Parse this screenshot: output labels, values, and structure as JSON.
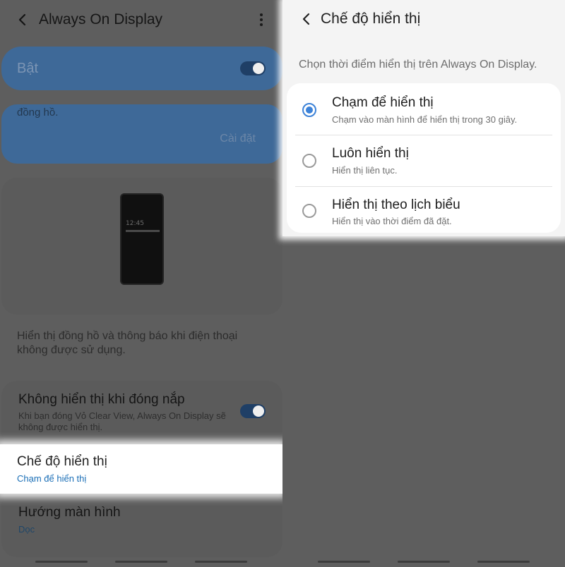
{
  "left": {
    "header": {
      "title": "Always On Display"
    },
    "master_toggle": {
      "label": "Bật",
      "on": true
    },
    "info": {
      "text": "đồng hồ.",
      "settings_button": "Cài đặt"
    },
    "preview": {
      "clock": "12:45"
    },
    "description": "Hiển thị đồng hồ và thông báo khi điện thoại không được sử dụng.",
    "items": [
      {
        "title": "Không hiển thị khi đóng nắp",
        "subtitle": "Khi bạn đóng Vỏ Clear View, Always On Display sẽ không được hiển thị.",
        "toggle_on": true
      },
      {
        "title": "Chế độ hiển thị",
        "value": "Chạm để hiển thị"
      },
      {
        "title": "Hướng màn hình",
        "value": "Dọc"
      }
    ]
  },
  "right": {
    "header": {
      "title": "Chế độ hiển thị"
    },
    "subtitle": "Chọn thời điểm hiển thị trên Always On Display.",
    "options": [
      {
        "title": "Chạm để hiển thị",
        "subtitle": "Chạm vào màn hình để hiển thị trong 30 giây.",
        "selected": true
      },
      {
        "title": "Luôn hiển thị",
        "subtitle": "Hiển thị liên tục.",
        "selected": false
      },
      {
        "title": "Hiển thị theo lịch biểu",
        "subtitle": "Hiển thị vào thời điểm đã đặt.",
        "selected": false
      }
    ]
  },
  "colors": {
    "accent": "#3c82d8",
    "link": "#1b6fb7",
    "dim_overlay": "#5e5e5e"
  },
  "icons": [
    "back-arrow-icon",
    "more-options-icon",
    "toggle-switch",
    "radio-button"
  ]
}
